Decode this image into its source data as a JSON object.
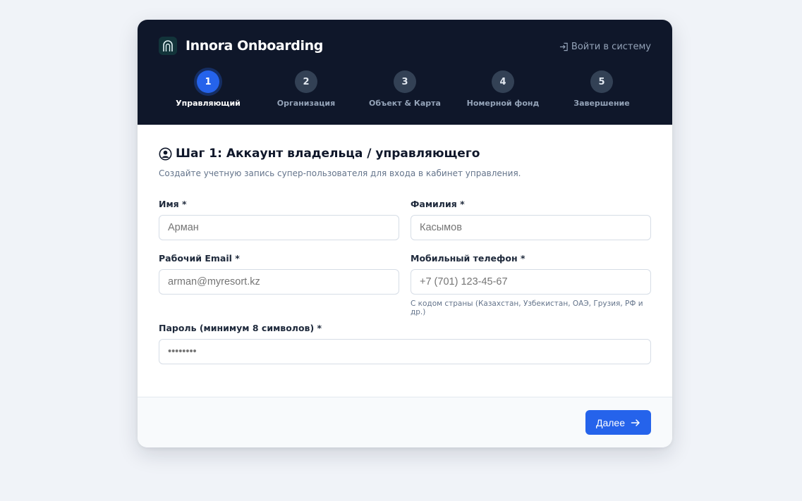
{
  "header": {
    "brand_name": "Innora Onboarding",
    "login_link": "Войти в систему"
  },
  "steps": [
    {
      "number": "1",
      "label": "Управляющий",
      "active": true
    },
    {
      "number": "2",
      "label": "Организация",
      "active": false
    },
    {
      "number": "3",
      "label": "Объект & Карта",
      "active": false
    },
    {
      "number": "4",
      "label": "Номерной фонд",
      "active": false
    },
    {
      "number": "5",
      "label": "Завершение",
      "active": false
    }
  ],
  "form": {
    "title": "Шаг 1: Аккаунт владельца / управляющего",
    "subtitle": "Создайте учетную запись супер-пользователя для входа в кабинет управления.",
    "first_name": {
      "label": "Имя *",
      "placeholder": "Арман"
    },
    "last_name": {
      "label": "Фамилия *",
      "placeholder": "Касымов"
    },
    "email": {
      "label": "Рабочий Email *",
      "placeholder": "arman@myresort.kz"
    },
    "phone": {
      "label": "Мобильный телефон *",
      "placeholder": "+7 (701) 123-45-67",
      "hint": "С кодом страны (Казахстан, Узбекистан, ОАЭ, Грузия, РФ и др.)"
    },
    "password": {
      "label": "Пароль (минимум 8 символов) *",
      "placeholder": "••••••••"
    }
  },
  "footer": {
    "next_label": "Далее"
  },
  "colors": {
    "accent": "#2563eb",
    "header_bg": "#0f172a",
    "page_bg": "#f0f3f8"
  }
}
